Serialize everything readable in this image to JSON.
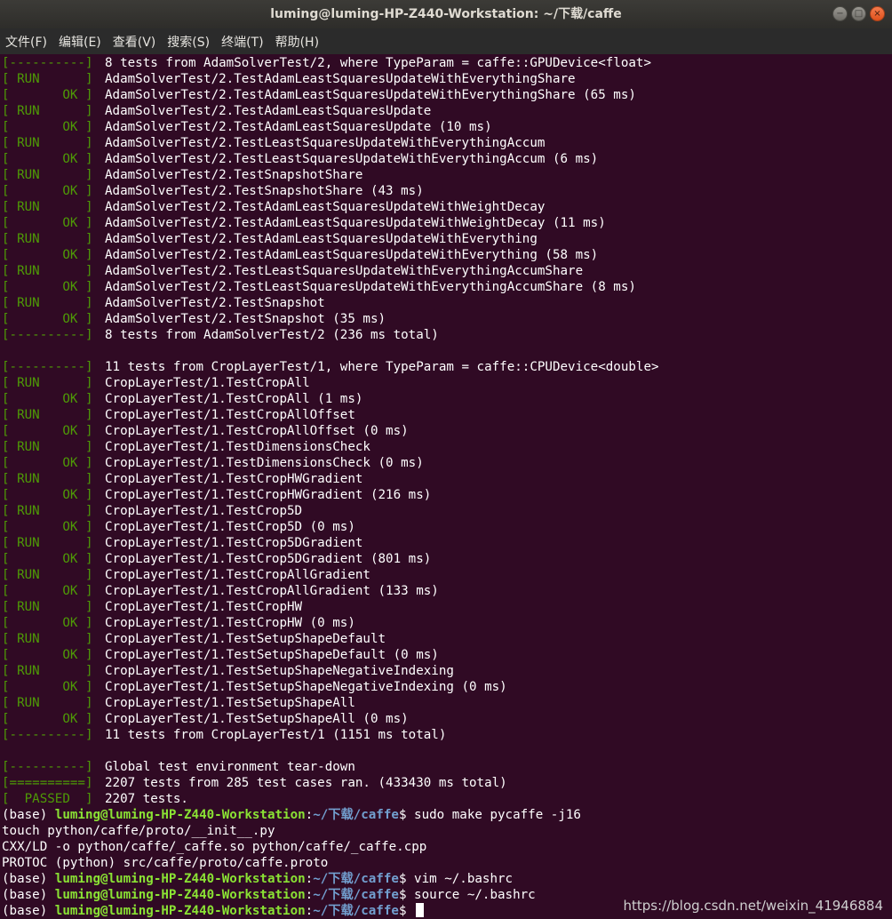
{
  "window": {
    "title": "luming@luming-HP-Z440-Workstation: ~/下载/caffe"
  },
  "menubar": {
    "items": [
      "文件(F)",
      "编辑(E)",
      "查看(V)",
      "搜索(S)",
      "终端(T)",
      "帮助(H)"
    ]
  },
  "terminal": {
    "test_lines": [
      {
        "tag": "[----------]",
        "msg": "8 tests from AdamSolverTest/2, where TypeParam = caffe::GPUDevice<float>"
      },
      {
        "tag": "[ RUN      ]",
        "msg": "AdamSolverTest/2.TestAdamLeastSquaresUpdateWithEverythingShare"
      },
      {
        "tag": "[       OK ]",
        "msg": "AdamSolverTest/2.TestAdamLeastSquaresUpdateWithEverythingShare (65 ms)"
      },
      {
        "tag": "[ RUN      ]",
        "msg": "AdamSolverTest/2.TestAdamLeastSquaresUpdate"
      },
      {
        "tag": "[       OK ]",
        "msg": "AdamSolverTest/2.TestAdamLeastSquaresUpdate (10 ms)"
      },
      {
        "tag": "[ RUN      ]",
        "msg": "AdamSolverTest/2.TestLeastSquaresUpdateWithEverythingAccum"
      },
      {
        "tag": "[       OK ]",
        "msg": "AdamSolverTest/2.TestLeastSquaresUpdateWithEverythingAccum (6 ms)"
      },
      {
        "tag": "[ RUN      ]",
        "msg": "AdamSolverTest/2.TestSnapshotShare"
      },
      {
        "tag": "[       OK ]",
        "msg": "AdamSolverTest/2.TestSnapshotShare (43 ms)"
      },
      {
        "tag": "[ RUN      ]",
        "msg": "AdamSolverTest/2.TestAdamLeastSquaresUpdateWithWeightDecay"
      },
      {
        "tag": "[       OK ]",
        "msg": "AdamSolverTest/2.TestAdamLeastSquaresUpdateWithWeightDecay (11 ms)"
      },
      {
        "tag": "[ RUN      ]",
        "msg": "AdamSolverTest/2.TestAdamLeastSquaresUpdateWithEverything"
      },
      {
        "tag": "[       OK ]",
        "msg": "AdamSolverTest/2.TestAdamLeastSquaresUpdateWithEverything (58 ms)"
      },
      {
        "tag": "[ RUN      ]",
        "msg": "AdamSolverTest/2.TestLeastSquaresUpdateWithEverythingAccumShare"
      },
      {
        "tag": "[       OK ]",
        "msg": "AdamSolverTest/2.TestLeastSquaresUpdateWithEverythingAccumShare (8 ms)"
      },
      {
        "tag": "[ RUN      ]",
        "msg": "AdamSolverTest/2.TestSnapshot"
      },
      {
        "tag": "[       OK ]",
        "msg": "AdamSolverTest/2.TestSnapshot (35 ms)"
      },
      {
        "tag": "[----------]",
        "msg": "8 tests from AdamSolverTest/2 (236 ms total)"
      },
      {
        "tag": "",
        "msg": ""
      },
      {
        "tag": "[----------]",
        "msg": "11 tests from CropLayerTest/1, where TypeParam = caffe::CPUDevice<double>"
      },
      {
        "tag": "[ RUN      ]",
        "msg": "CropLayerTest/1.TestCropAll"
      },
      {
        "tag": "[       OK ]",
        "msg": "CropLayerTest/1.TestCropAll (1 ms)"
      },
      {
        "tag": "[ RUN      ]",
        "msg": "CropLayerTest/1.TestCropAllOffset"
      },
      {
        "tag": "[       OK ]",
        "msg": "CropLayerTest/1.TestCropAllOffset (0 ms)"
      },
      {
        "tag": "[ RUN      ]",
        "msg": "CropLayerTest/1.TestDimensionsCheck"
      },
      {
        "tag": "[       OK ]",
        "msg": "CropLayerTest/1.TestDimensionsCheck (0 ms)"
      },
      {
        "tag": "[ RUN      ]",
        "msg": "CropLayerTest/1.TestCropHWGradient"
      },
      {
        "tag": "[       OK ]",
        "msg": "CropLayerTest/1.TestCropHWGradient (216 ms)"
      },
      {
        "tag": "[ RUN      ]",
        "msg": "CropLayerTest/1.TestCrop5D"
      },
      {
        "tag": "[       OK ]",
        "msg": "CropLayerTest/1.TestCrop5D (0 ms)"
      },
      {
        "tag": "[ RUN      ]",
        "msg": "CropLayerTest/1.TestCrop5DGradient"
      },
      {
        "tag": "[       OK ]",
        "msg": "CropLayerTest/1.TestCrop5DGradient (801 ms)"
      },
      {
        "tag": "[ RUN      ]",
        "msg": "CropLayerTest/1.TestCropAllGradient"
      },
      {
        "tag": "[       OK ]",
        "msg": "CropLayerTest/1.TestCropAllGradient (133 ms)"
      },
      {
        "tag": "[ RUN      ]",
        "msg": "CropLayerTest/1.TestCropHW"
      },
      {
        "tag": "[       OK ]",
        "msg": "CropLayerTest/1.TestCropHW (0 ms)"
      },
      {
        "tag": "[ RUN      ]",
        "msg": "CropLayerTest/1.TestSetupShapeDefault"
      },
      {
        "tag": "[       OK ]",
        "msg": "CropLayerTest/1.TestSetupShapeDefault (0 ms)"
      },
      {
        "tag": "[ RUN      ]",
        "msg": "CropLayerTest/1.TestSetupShapeNegativeIndexing"
      },
      {
        "tag": "[       OK ]",
        "msg": "CropLayerTest/1.TestSetupShapeNegativeIndexing (0 ms)"
      },
      {
        "tag": "[ RUN      ]",
        "msg": "CropLayerTest/1.TestSetupShapeAll"
      },
      {
        "tag": "[       OK ]",
        "msg": "CropLayerTest/1.TestSetupShapeAll (0 ms)"
      },
      {
        "tag": "[----------]",
        "msg": "11 tests from CropLayerTest/1 (1151 ms total)"
      },
      {
        "tag": "",
        "msg": ""
      },
      {
        "tag": "[----------]",
        "msg": "Global test environment tear-down"
      },
      {
        "tag": "[==========]",
        "msg": "2207 tests from 285 test cases ran. (433430 ms total)"
      },
      {
        "tag": "[  PASSED  ]",
        "msg": "2207 tests."
      }
    ],
    "shell_lines": [
      {
        "type": "prompt",
        "env": "(base) ",
        "user": "luming@luming-HP-Z440-Workstation",
        "sep": ":",
        "path": "~/下载/caffe",
        "dollar": "$ ",
        "cmd": "sudo make pycaffe -j16"
      },
      {
        "type": "output",
        "text": "touch python/caffe/proto/__init__.py"
      },
      {
        "type": "output",
        "text": "CXX/LD -o python/caffe/_caffe.so python/caffe/_caffe.cpp"
      },
      {
        "type": "output",
        "text": "PROTOC (python) src/caffe/proto/caffe.proto"
      },
      {
        "type": "prompt",
        "env": "(base) ",
        "user": "luming@luming-HP-Z440-Workstation",
        "sep": ":",
        "path": "~/下载/caffe",
        "dollar": "$ ",
        "cmd": "vim ~/.bashrc"
      },
      {
        "type": "prompt",
        "env": "(base) ",
        "user": "luming@luming-HP-Z440-Workstation",
        "sep": ":",
        "path": "~/下载/caffe",
        "dollar": "$ ",
        "cmd": "source ~/.bashrc"
      },
      {
        "type": "prompt",
        "env": "(base) ",
        "user": "luming@luming-HP-Z440-Workstation",
        "sep": ":",
        "path": "~/下载/caffe",
        "dollar": "$ ",
        "cmd": "",
        "cursor": true
      }
    ]
  },
  "watermark": {
    "text": "https://blog.csdn.net/weixin_41946884"
  },
  "colors": {
    "background": "#300a24",
    "status_green": "#4e9a06",
    "prompt_user": "#8ae234",
    "prompt_path": "#729fcf"
  },
  "icons": {
    "minimize": "minimize-icon",
    "maximize": "maximize-icon",
    "close": "close-icon"
  }
}
